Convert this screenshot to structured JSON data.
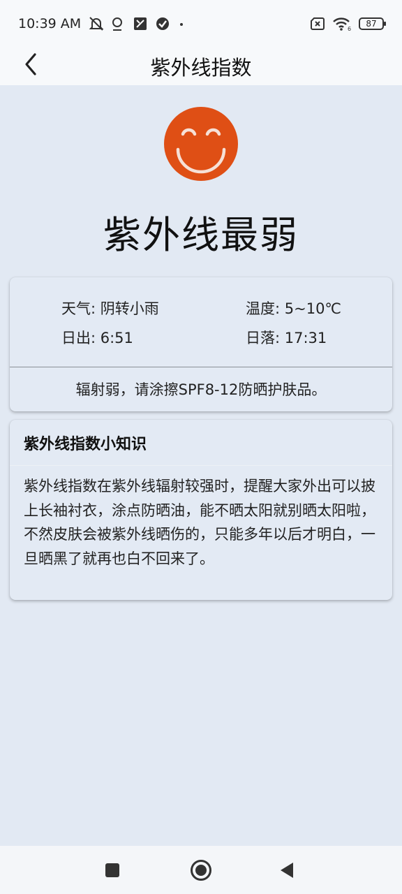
{
  "status_bar": {
    "time": "10:39 AM",
    "battery": "87",
    "icons": [
      "mute-icon",
      "location-icon",
      "app-icon",
      "check-circle-icon",
      "dot-icon",
      "sim-error-icon",
      "wifi-icon",
      "battery-icon"
    ]
  },
  "app_bar": {
    "title": "紫外线指数",
    "back_icon": "chevron-left-icon"
  },
  "hero": {
    "face_icon": "smiley-face-icon",
    "face_color": "#df4f15",
    "uv_level": "紫外线最弱"
  },
  "weather_card": {
    "weather": "天气: 阴转小雨",
    "temperature": "温度: 5~10℃",
    "sunrise": "日出: 6:51",
    "sunset": "日落: 17:31",
    "advice": "辐射弱，请涂擦SPF8-12防晒护肤品。"
  },
  "tips_card": {
    "title": "紫外线指数小知识",
    "body": "紫外线指数在紫外线辐射较强时，提醒大家外出可以披上长袖衬衣，涂点防晒油，能不晒太阳就别晒太阳啦，不然皮肤会被紫外线晒伤的，只能多年以后才明白，一旦晒黑了就再也白不回来了。"
  },
  "nav_bar": {
    "icons": [
      "square-icon",
      "home-circle-icon",
      "back-triangle-icon"
    ]
  }
}
